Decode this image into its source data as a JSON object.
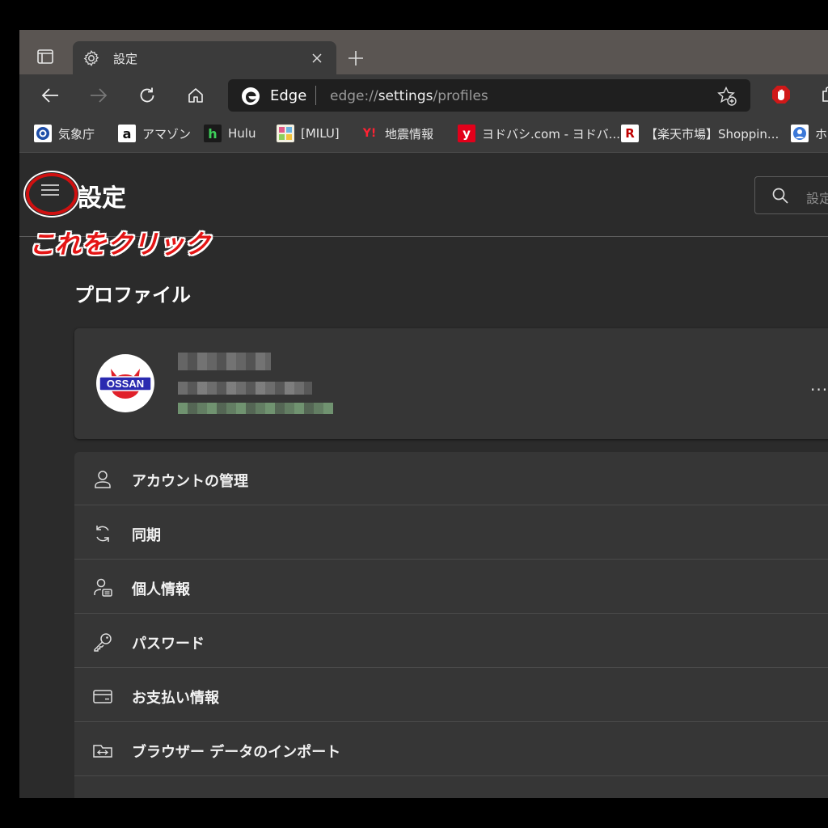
{
  "tab": {
    "title": "設定",
    "close": "×",
    "new_tab": "+"
  },
  "address_bar": {
    "site": "Edge",
    "url_prefix": "edge://",
    "url_bold": "settings",
    "url_suffix": "/profiles"
  },
  "favorites": [
    {
      "label": "気象庁",
      "icon": "jma-icon"
    },
    {
      "label": "アマゾン",
      "icon": "amazon-icon"
    },
    {
      "label": "Hulu",
      "icon": "hulu-icon"
    },
    {
      "label": "[MILU]",
      "icon": "milu-icon"
    },
    {
      "label": "地震情報",
      "icon": "yahoo-icon"
    },
    {
      "label": "ヨドバシ.com - ヨドバ...",
      "icon": "yodobashi-icon"
    },
    {
      "label": "【楽天市場】Shoppin...",
      "icon": "rakuten-icon"
    },
    {
      "label": "ホ",
      "icon": "profile-fav-icon"
    }
  ],
  "settings": {
    "title": "設定",
    "search_placeholder": "設定",
    "annotation": "これをクリック",
    "section_title": "プロファイル",
    "avatar_text": "OSSAN",
    "more": "...",
    "menu": [
      {
        "label": "アカウントの管理",
        "icon": "person-icon"
      },
      {
        "label": "同期",
        "icon": "sync-icon"
      },
      {
        "label": "個人情報",
        "icon": "personal-info-icon"
      },
      {
        "label": "パスワード",
        "icon": "key-icon"
      },
      {
        "label": "お支払い情報",
        "icon": "card-icon"
      },
      {
        "label": "ブラウザー データのインポート",
        "icon": "import-icon"
      }
    ]
  },
  "colors": {
    "annotation_red": "#e41414",
    "page_bg": "#2b2b2b",
    "card_bg": "#363636",
    "avatar_blue": "#2a2ab0",
    "avatar_red": "#e0202a"
  }
}
